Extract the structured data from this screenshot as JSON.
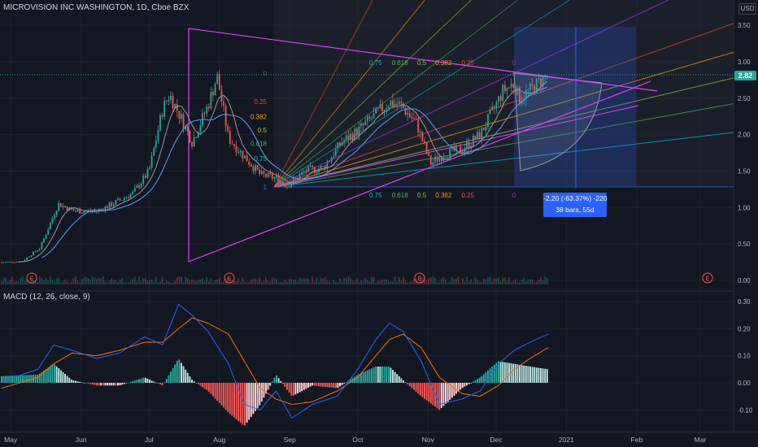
{
  "header": {
    "title": "MICROVISION INC WASHINGTON, 1D, Cboe BZX",
    "currency": "USD",
    "last_price": "2.82"
  },
  "macd_panel": {
    "title": "MACD (12, 26, close, 9)"
  },
  "measure": {
    "line1": "-2.20 (-63.37%) -220",
    "line2": "38 bars, 55d"
  },
  "colors": {
    "background": "#131722",
    "up": "#26a69a",
    "down": "#ef5350",
    "macd_line": "#2962ff",
    "signal_line": "#ff6d00",
    "trend": "#e040fb",
    "measure": "#2962ff"
  },
  "chart_data": [
    {
      "type": "candlestick",
      "title": "MICROVISION INC WASHINGTON, 1D, Cboe BZX",
      "x_tick_labels": [
        "May",
        "Jun",
        "Jul",
        "Aug",
        "Sep",
        "Oct",
        "Nov",
        "Dec",
        "2021",
        "Feb",
        "Mar"
      ],
      "y_tick_labels": [
        "3.50",
        "3.00",
        "2.50",
        "2.00",
        "1.50",
        "1.00",
        "0.50",
        "0.00"
      ],
      "ylim": [
        0,
        3.6
      ],
      "last_price": 2.82,
      "earnings_markers": [
        "E",
        "E",
        "E",
        "E"
      ],
      "close_path": [
        {
          "x": "2020-04-27",
          "y": 0.25
        },
        {
          "x": "2020-05-06",
          "y": 0.26
        },
        {
          "x": "2020-05-14",
          "y": 0.45
        },
        {
          "x": "2020-05-22",
          "y": 1.05
        },
        {
          "x": "2020-05-29",
          "y": 0.95
        },
        {
          "x": "2020-06-08",
          "y": 0.95
        },
        {
          "x": "2020-06-15",
          "y": 1.05
        },
        {
          "x": "2020-06-24",
          "y": 1.2
        },
        {
          "x": "2020-07-01",
          "y": 1.5
        },
        {
          "x": "2020-07-07",
          "y": 2.35
        },
        {
          "x": "2020-07-10",
          "y": 2.55
        },
        {
          "x": "2020-07-14",
          "y": 2.3
        },
        {
          "x": "2020-07-20",
          "y": 1.9
        },
        {
          "x": "2020-07-27",
          "y": 2.4
        },
        {
          "x": "2020-07-31",
          "y": 2.8
        },
        {
          "x": "2020-08-05",
          "y": 1.95
        },
        {
          "x": "2020-08-12",
          "y": 1.7
        },
        {
          "x": "2020-08-19",
          "y": 1.45
        },
        {
          "x": "2020-08-26",
          "y": 1.4
        },
        {
          "x": "2020-08-31",
          "y": 1.3
        },
        {
          "x": "2020-09-08",
          "y": 1.5
        },
        {
          "x": "2020-09-16",
          "y": 1.55
        },
        {
          "x": "2020-09-24",
          "y": 1.9
        },
        {
          "x": "2020-10-01",
          "y": 2.05
        },
        {
          "x": "2020-10-08",
          "y": 2.25
        },
        {
          "x": "2020-10-15",
          "y": 2.45
        },
        {
          "x": "2020-10-20",
          "y": 2.4
        },
        {
          "x": "2020-10-27",
          "y": 2.15
        },
        {
          "x": "2020-11-02",
          "y": 1.6
        },
        {
          "x": "2020-11-09",
          "y": 1.75
        },
        {
          "x": "2020-11-16",
          "y": 1.8
        },
        {
          "x": "2020-11-24",
          "y": 2.0
        },
        {
          "x": "2020-11-30",
          "y": 2.35
        },
        {
          "x": "2020-12-04",
          "y": 2.6
        },
        {
          "x": "2020-12-09",
          "y": 2.7
        },
        {
          "x": "2020-12-11",
          "y": 2.5
        },
        {
          "x": "2020-12-16",
          "y": 2.6
        },
        {
          "x": "2020-12-21",
          "y": 2.75
        },
        {
          "x": "2020-12-24",
          "y": 2.82
        }
      ],
      "fib_fan_ratios": [
        "0.75",
        "0.618",
        "0.5",
        "0.382",
        "0.25",
        "0"
      ],
      "fib_fan_levels": [
        "1",
        "0.75",
        "0.618",
        "0.5",
        "0.382",
        "0.25",
        "0"
      ]
    },
    {
      "type": "line",
      "title": "MACD (12, 26, close, 9)",
      "y_tick_labels": [
        "0.30",
        "0.20",
        "0.10",
        "0.00",
        "-0.10"
      ],
      "ylim": [
        -0.13,
        0.32
      ],
      "series": [
        {
          "name": "MACD",
          "values": [
            {
              "x": "2020-04-27",
              "y": 0.005
            },
            {
              "x": "2020-05-13",
              "y": 0.05
            },
            {
              "x": "2020-05-20",
              "y": 0.14
            },
            {
              "x": "2020-05-28",
              "y": 0.12
            },
            {
              "x": "2020-06-08",
              "y": 0.09
            },
            {
              "x": "2020-06-18",
              "y": 0.11
            },
            {
              "x": "2020-06-29",
              "y": 0.17
            },
            {
              "x": "2020-07-07",
              "y": 0.14
            },
            {
              "x": "2020-07-14",
              "y": 0.29
            },
            {
              "x": "2020-07-20",
              "y": 0.25
            },
            {
              "x": "2020-07-27",
              "y": 0.19
            },
            {
              "x": "2020-08-05",
              "y": 0.07
            },
            {
              "x": "2020-08-12",
              "y": -0.08
            },
            {
              "x": "2020-08-19",
              "y": -0.1
            },
            {
              "x": "2020-08-26",
              "y": -0.03
            },
            {
              "x": "2020-09-02",
              "y": -0.13
            },
            {
              "x": "2020-09-11",
              "y": -0.08
            },
            {
              "x": "2020-09-22",
              "y": -0.05
            },
            {
              "x": "2020-10-01",
              "y": 0.05
            },
            {
              "x": "2020-10-09",
              "y": 0.16
            },
            {
              "x": "2020-10-15",
              "y": 0.22
            },
            {
              "x": "2020-10-21",
              "y": 0.19
            },
            {
              "x": "2020-10-29",
              "y": 0.08
            },
            {
              "x": "2020-11-06",
              "y": -0.08
            },
            {
              "x": "2020-11-16",
              "y": -0.06
            },
            {
              "x": "2020-11-24",
              "y": -0.03
            },
            {
              "x": "2020-12-02",
              "y": 0.07
            },
            {
              "x": "2020-12-09",
              "y": 0.12
            },
            {
              "x": "2020-12-16",
              "y": 0.15
            },
            {
              "x": "2020-12-24",
              "y": 0.18
            }
          ]
        },
        {
          "name": "Signal",
          "values": [
            {
              "x": "2020-04-27",
              "y": -0.02
            },
            {
              "x": "2020-05-13",
              "y": 0.02
            },
            {
              "x": "2020-05-20",
              "y": 0.07
            },
            {
              "x": "2020-05-28",
              "y": 0.11
            },
            {
              "x": "2020-06-08",
              "y": 0.1
            },
            {
              "x": "2020-06-18",
              "y": 0.12
            },
            {
              "x": "2020-06-29",
              "y": 0.15
            },
            {
              "x": "2020-07-07",
              "y": 0.15
            },
            {
              "x": "2020-07-14",
              "y": 0.2
            },
            {
              "x": "2020-07-20",
              "y": 0.24
            },
            {
              "x": "2020-07-27",
              "y": 0.22
            },
            {
              "x": "2020-08-05",
              "y": 0.18
            },
            {
              "x": "2020-08-12",
              "y": 0.08
            },
            {
              "x": "2020-08-19",
              "y": -0.02
            },
            {
              "x": "2020-08-26",
              "y": -0.06
            },
            {
              "x": "2020-09-02",
              "y": -0.08
            },
            {
              "x": "2020-09-11",
              "y": -0.07
            },
            {
              "x": "2020-09-22",
              "y": -0.03
            },
            {
              "x": "2020-10-01",
              "y": 0.02
            },
            {
              "x": "2020-10-09",
              "y": 0.1
            },
            {
              "x": "2020-10-15",
              "y": 0.16
            },
            {
              "x": "2020-10-21",
              "y": 0.18
            },
            {
              "x": "2020-10-29",
              "y": 0.13
            },
            {
              "x": "2020-11-06",
              "y": 0.02
            },
            {
              "x": "2020-11-16",
              "y": -0.04
            },
            {
              "x": "2020-11-24",
              "y": -0.05
            },
            {
              "x": "2020-12-02",
              "y": -0.01
            },
            {
              "x": "2020-12-09",
              "y": 0.05
            },
            {
              "x": "2020-12-16",
              "y": 0.09
            },
            {
              "x": "2020-12-24",
              "y": 0.13
            }
          ]
        }
      ]
    }
  ]
}
